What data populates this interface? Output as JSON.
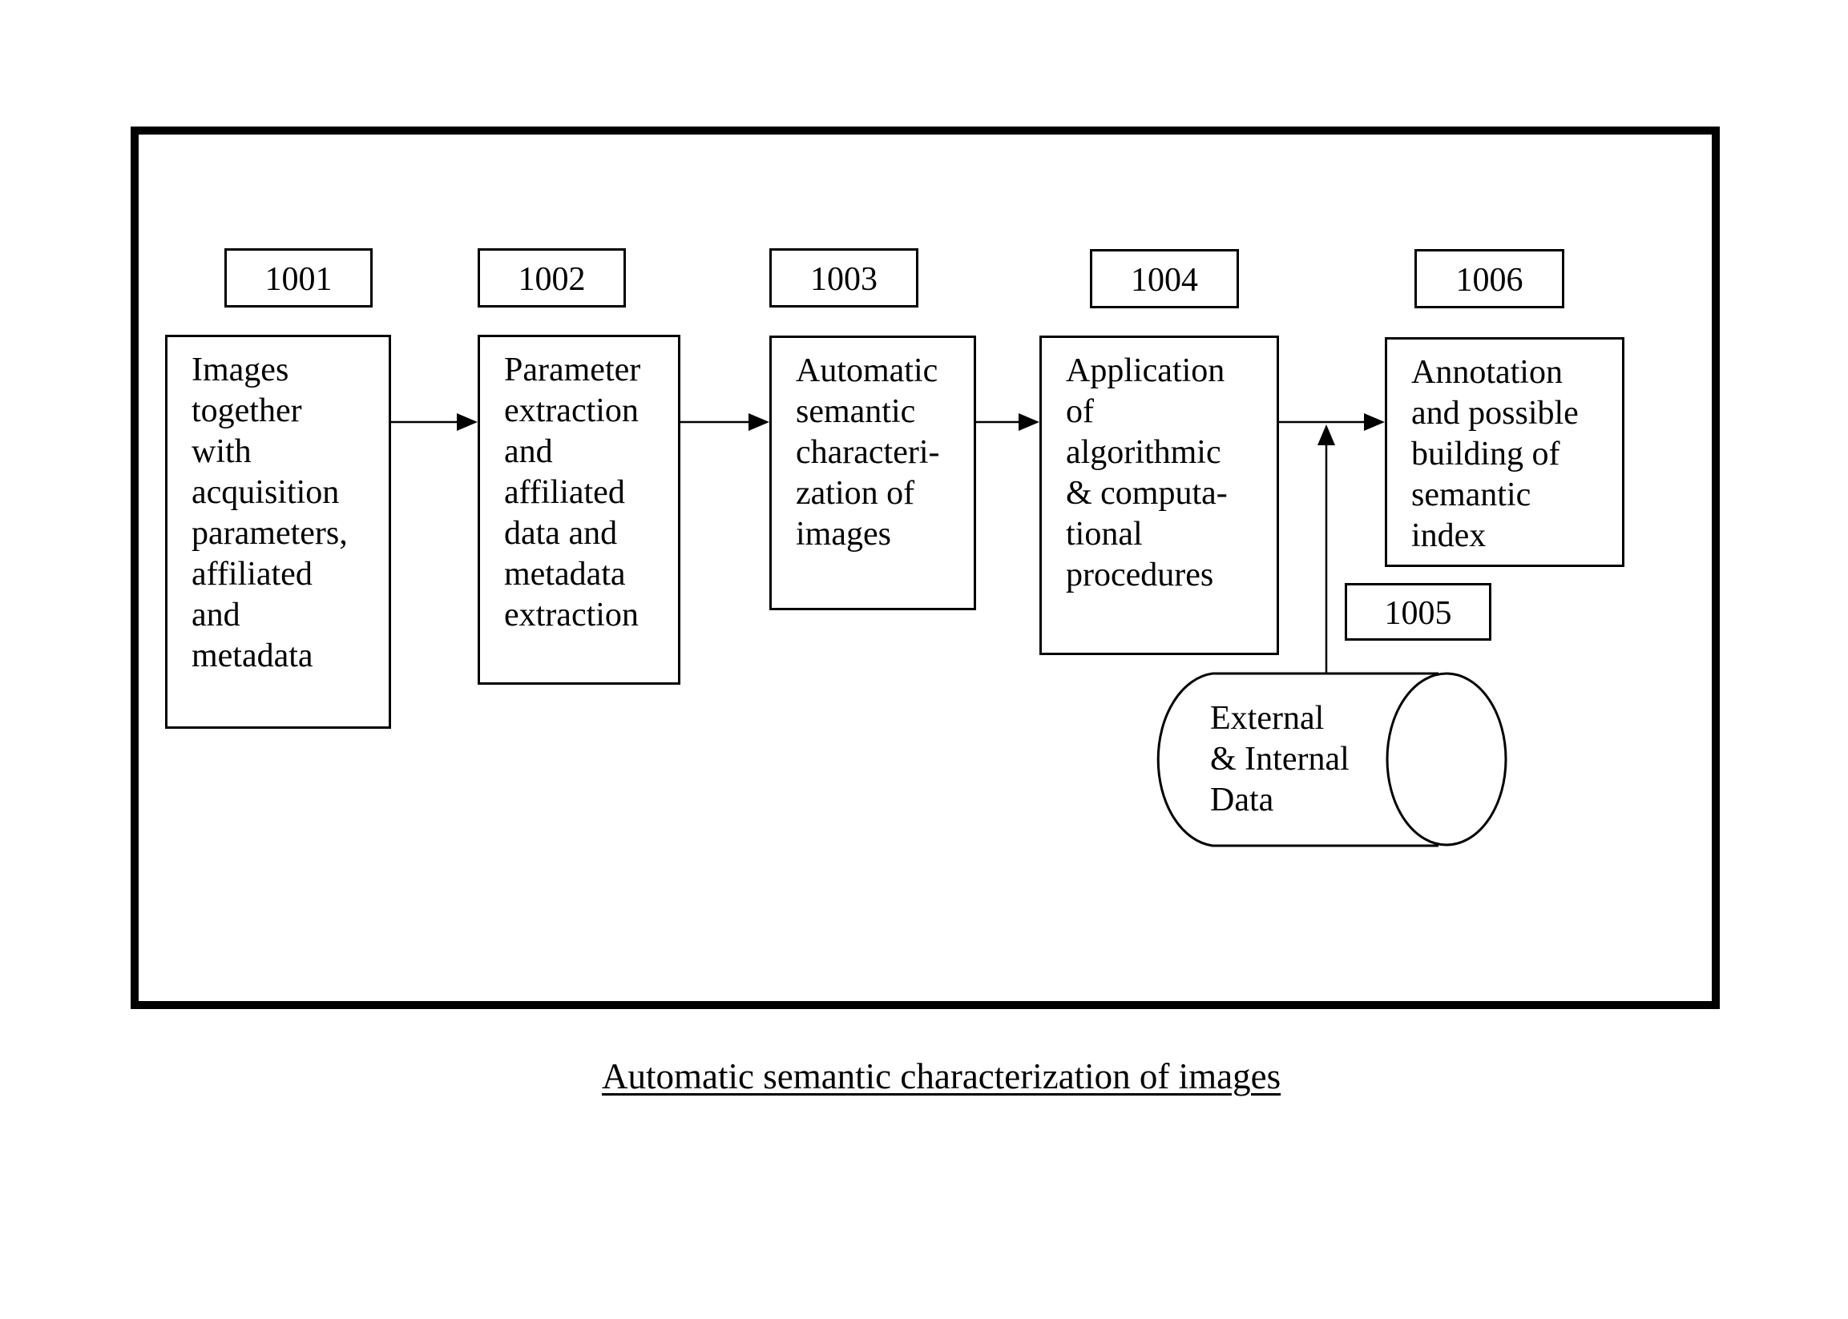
{
  "diagram": {
    "type": "flowchart",
    "caption": "Automatic semantic characterization of images",
    "nodes": [
      {
        "id": "1001",
        "label": "1001",
        "lines": [
          "Images",
          "together",
          "with",
          "acquisition",
          "parameters,",
          "affiliated",
          "and",
          "metadata"
        ]
      },
      {
        "id": "1002",
        "label": "1002",
        "lines": [
          "Parameter",
          "extraction",
          "and",
          "affiliated",
          "data and",
          "metadata",
          "extraction"
        ]
      },
      {
        "id": "1003",
        "label": "1003",
        "lines": [
          "Automatic",
          "semantic",
          "characteri-",
          "zation of",
          "images"
        ]
      },
      {
        "id": "1004",
        "label": "1004",
        "lines": [
          "Application",
          "of",
          "algorithmic",
          "& computa-",
          "tional",
          "procedures"
        ]
      },
      {
        "id": "1006",
        "label": "1006",
        "lines": [
          "Annotation",
          "and possible",
          "building of",
          "semantic",
          "index"
        ]
      },
      {
        "id": "1005",
        "label": "1005",
        "shape": "cylinder",
        "lines": [
          "External",
          "& Internal",
          "Data"
        ]
      }
    ],
    "edges": [
      {
        "from": "1001",
        "to": "1002"
      },
      {
        "from": "1002",
        "to": "1003"
      },
      {
        "from": "1003",
        "to": "1004"
      },
      {
        "from": "1004",
        "to": "1006"
      },
      {
        "from": "1005",
        "to": "1004-1006-edge"
      }
    ]
  }
}
